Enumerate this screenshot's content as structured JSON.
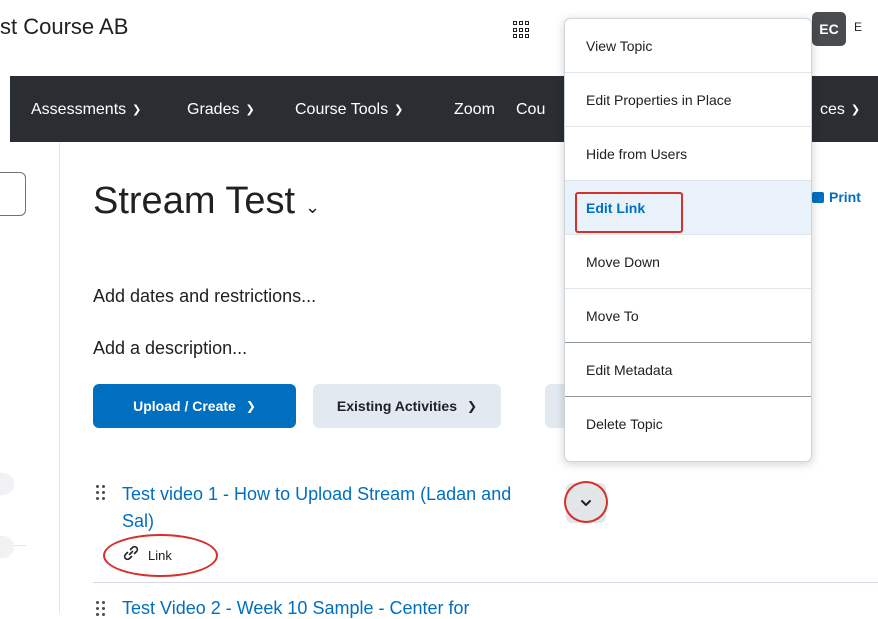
{
  "header": {
    "course_title": "st Course AB",
    "avatar_initials": "EC",
    "avatar_trail": "E"
  },
  "nav": {
    "items": [
      {
        "label": "Assessments",
        "has_chevron": true
      },
      {
        "label": "Grades",
        "has_chevron": true
      },
      {
        "label": "Course Tools",
        "has_chevron": true
      },
      {
        "label": "Zoom",
        "has_chevron": false
      },
      {
        "label": "Cou",
        "has_chevron": false
      },
      {
        "label": "ces",
        "has_chevron": true
      }
    ]
  },
  "module": {
    "title": "Stream Test",
    "print_label": "Print",
    "add_dates_label": "Add dates and restrictions...",
    "add_description_label": "Add a description...",
    "upload_button_label": "Upload / Create",
    "existing_activities_label": "Existing Activities"
  },
  "topics": [
    {
      "title": "Test video 1 - How to Upload Stream (Ladan and Sal)",
      "type_label": "Link"
    },
    {
      "title": "Test Video 2 - Week 10 Sample - Center for"
    }
  ],
  "context_menu": {
    "items": [
      {
        "label": "View Topic"
      },
      {
        "label": "Edit Properties in Place"
      },
      {
        "label": "Hide from Users"
      },
      {
        "label": "Edit Link",
        "highlighted": true
      },
      {
        "label": "Move Down"
      },
      {
        "label": "Move To"
      },
      {
        "label": "Edit Metadata"
      },
      {
        "label": "Delete Topic"
      }
    ]
  },
  "colors": {
    "accent": "#006fbf",
    "navbar": "#2a2e33",
    "annotation_red": "#d6302b",
    "notification": "#e87511"
  },
  "icons": {
    "apps": "waffle-grid-icon",
    "print": "printer-icon",
    "link": "link-icon",
    "drag": "drag-handle-icon",
    "menu_toggle": "chevron-down-icon"
  }
}
